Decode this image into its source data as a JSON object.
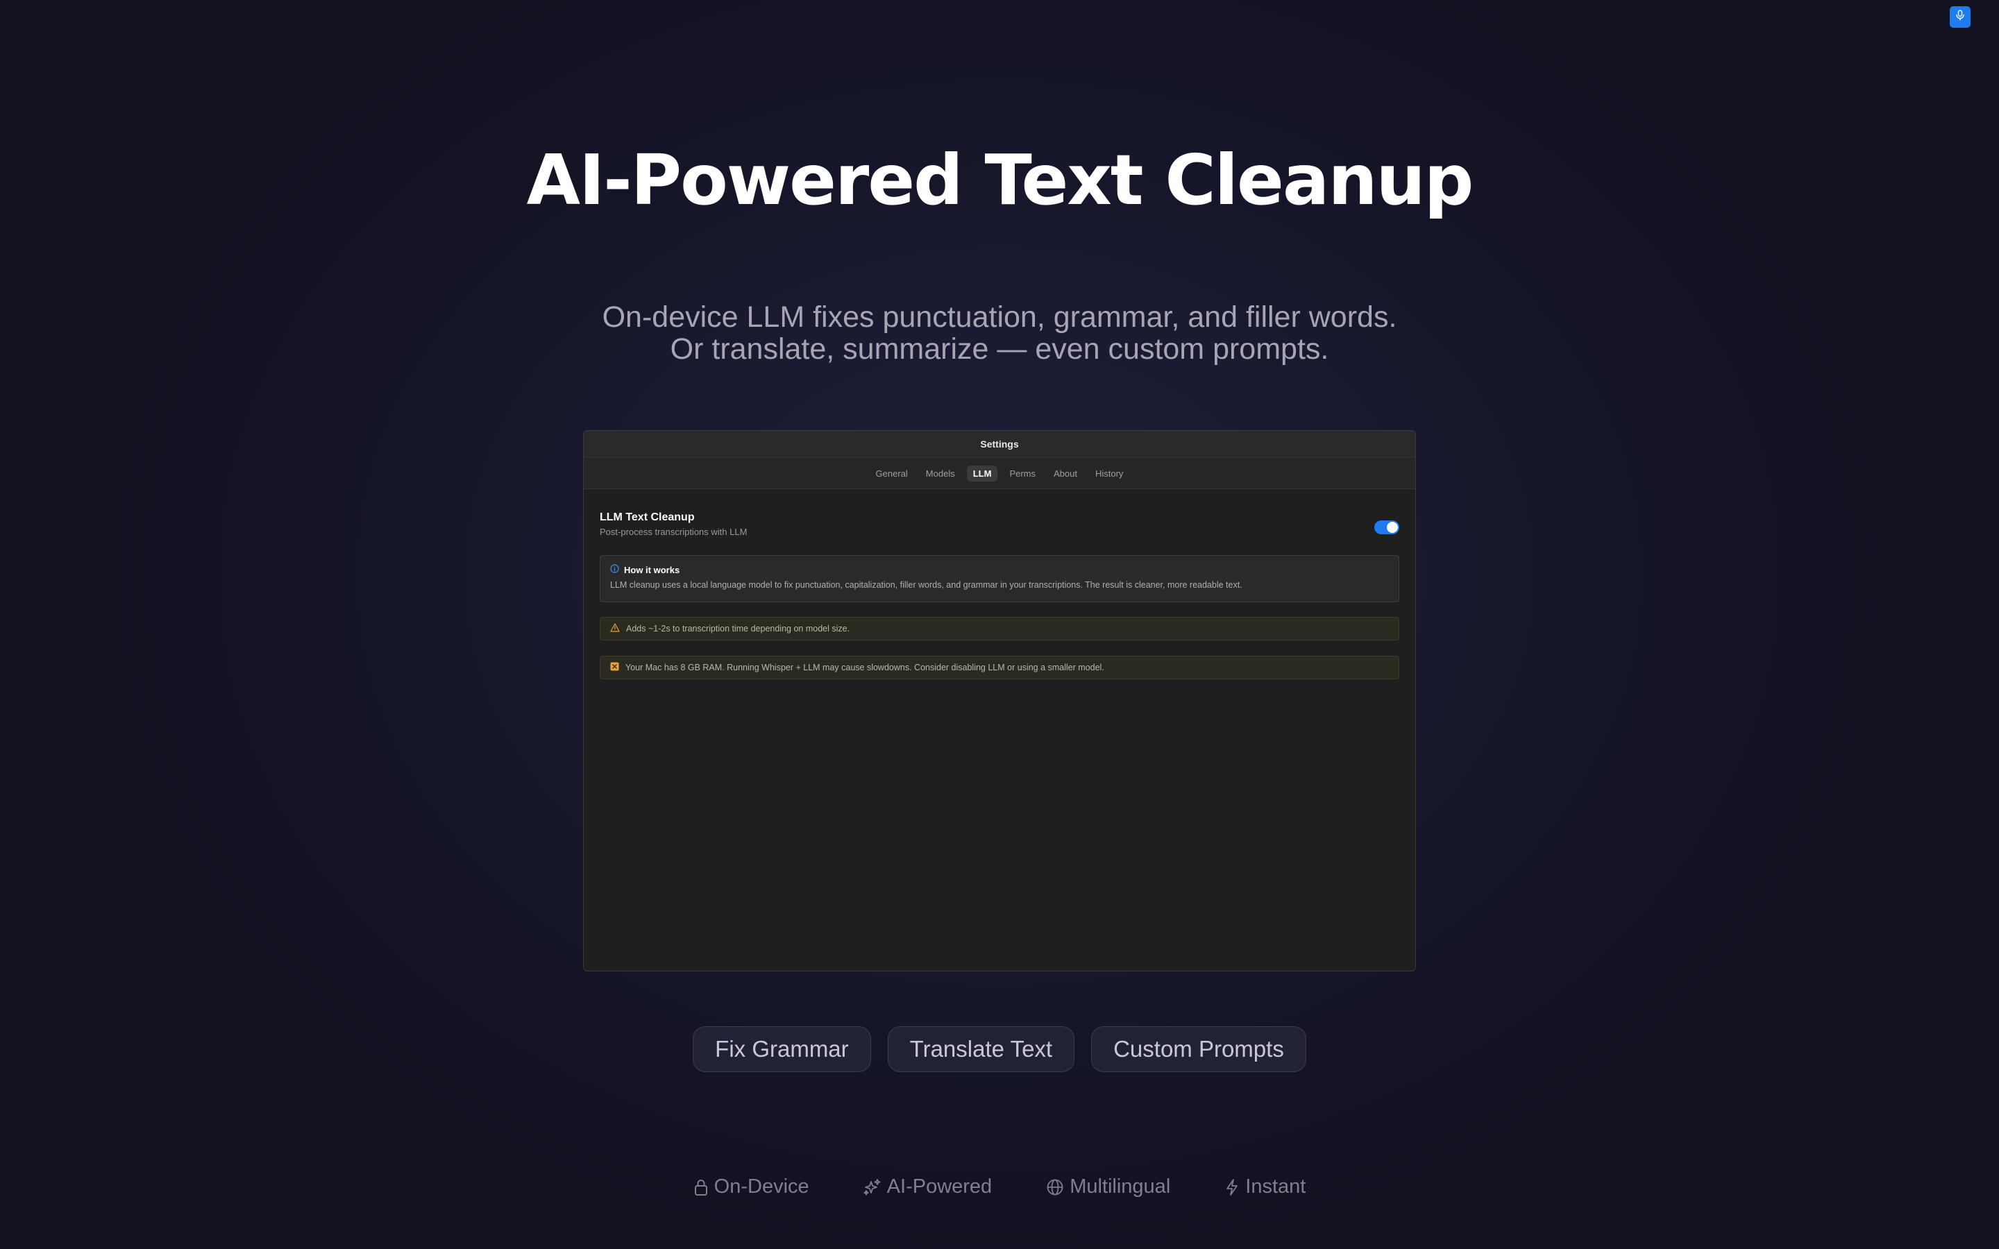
{
  "corner": {
    "icon": "microphone-icon"
  },
  "hero": {
    "title": "AI-Powered Text Cleanup",
    "subtitle": "On-device LLM fixes punctuation, grammar, and filler words. Or translate, summarize — even custom prompts."
  },
  "settings": {
    "title": "Settings",
    "tabs": [
      {
        "label": "General",
        "active": false
      },
      {
        "label": "Models",
        "active": false
      },
      {
        "label": "LLM",
        "active": true
      },
      {
        "label": "Perms",
        "active": false
      },
      {
        "label": "About",
        "active": false
      },
      {
        "label": "History",
        "active": false
      }
    ],
    "cleanup": {
      "title": "LLM Text Cleanup",
      "subtitle": "Post-process transcriptions with LLM",
      "enabled": true
    },
    "info": {
      "heading": "How it works",
      "text": "LLM cleanup uses a local language model to fix punctuation, capitalization, filler words, and grammar in your transcriptions. The result is cleaner, more readable text.",
      "icon": "info-icon"
    },
    "notices": [
      {
        "text": "Adds ~1-2s to transcription time depending on model size.",
        "icon": "warning-triangle-icon"
      },
      {
        "text": "Your Mac has 8 GB RAM. Running Whisper + LLM may cause slowdowns. Consider disabling LLM or using a smaller model.",
        "icon": "memory-chip-icon"
      }
    ]
  },
  "chips": [
    "Fix Grammar",
    "Translate Text",
    "Custom Prompts"
  ],
  "features": [
    {
      "label": "On-Device",
      "icon": "lock-icon"
    },
    {
      "label": "AI-Powered",
      "icon": "sparkles-icon"
    },
    {
      "label": "Multilingual",
      "icon": "globe-icon"
    },
    {
      "label": "Instant",
      "icon": "lightning-icon"
    }
  ],
  "colors": {
    "accent": "#1e7cf0",
    "warning": "#e8a23a"
  }
}
